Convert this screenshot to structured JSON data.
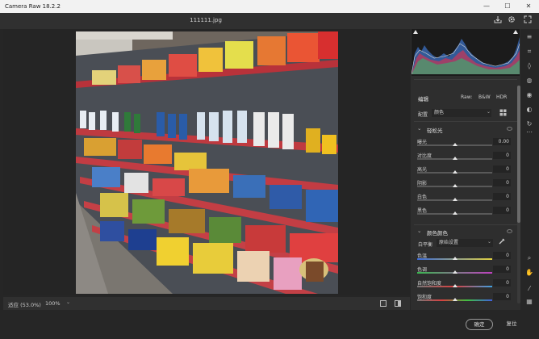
{
  "app": {
    "title": "Camera Raw 18.2.2"
  },
  "window_controls": [
    "—",
    "☐",
    "✕"
  ],
  "header": {
    "filename": "111111.jpg"
  },
  "footer": {
    "fit_label": "适应 (53.0%)",
    "zoom_label": "100%"
  },
  "bottom": {
    "ok_label": "确定",
    "reset_label": "复位"
  },
  "panel": {
    "section_title": "编辑",
    "tabs": [
      "Raw:",
      "B&W",
      "HDR"
    ],
    "profile_label": "配置",
    "profile_value": "颜色",
    "basic": {
      "title": "轻松光",
      "rows": [
        {
          "label": "曝光",
          "value": "0.00",
          "pos": 0.5
        },
        {
          "label": "对比度",
          "value": "0",
          "pos": 0.5
        },
        {
          "label": "高光",
          "value": "0",
          "pos": 0.5
        },
        {
          "label": "阴影",
          "value": "0",
          "pos": 0.5
        },
        {
          "label": "白色",
          "value": "0",
          "pos": 0.5
        },
        {
          "label": "黑色",
          "value": "0",
          "pos": 0.5
        }
      ]
    },
    "color": {
      "title": "颜色颜色",
      "wb_label": "白平衡",
      "wb_value": "原始设置",
      "rows": [
        {
          "label": "色温",
          "value": "0",
          "pos": 0.5
        },
        {
          "label": "色调",
          "value": "0",
          "pos": 0.5
        },
        {
          "label": "自然饱和度",
          "value": "0",
          "pos": 0.5
        },
        {
          "label": "饱和度",
          "value": "0",
          "pos": 0.5
        }
      ]
    }
  },
  "colors": {
    "accent": "#4a8fe0",
    "panel": "#2e2e2e"
  }
}
